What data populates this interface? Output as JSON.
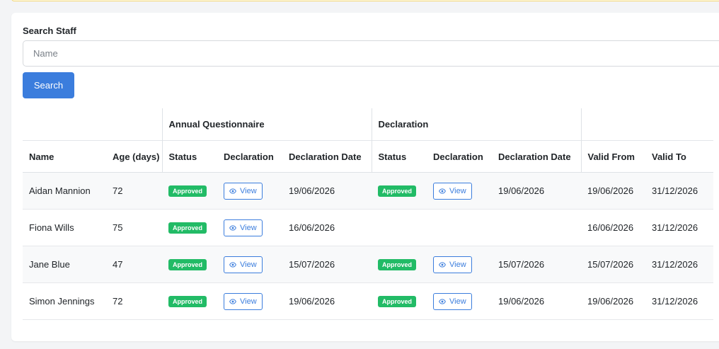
{
  "search": {
    "label": "Search Staff",
    "placeholder": "Name",
    "value": "",
    "button_label": "Search"
  },
  "table": {
    "groups": {
      "annual": "Annual Questionnaire",
      "declaration": "Declaration"
    },
    "columns": {
      "name": "Name",
      "age": "Age (days)",
      "aq_status": "Status",
      "aq_declaration": "Declaration",
      "aq_date": "Declaration Date",
      "d_status": "Status",
      "d_declaration": "Declaration",
      "d_date": "Declaration Date",
      "valid_from": "Valid From",
      "valid_to": "Valid To"
    },
    "rows": [
      {
        "name": "Aidan Mannion",
        "age": "72",
        "aq_status": "Approved",
        "aq_view": "View",
        "aq_date": "19/06/2026",
        "d_status": "Approved",
        "d_view": "View",
        "d_date": "19/06/2026",
        "valid_from": "19/06/2026",
        "valid_to": "31/12/2026"
      },
      {
        "name": "Fiona Wills",
        "age": "75",
        "aq_status": "Approved",
        "aq_view": "View",
        "aq_date": "16/06/2026",
        "d_status": "",
        "d_view": "",
        "d_date": "",
        "valid_from": "16/06/2026",
        "valid_to": "31/12/2026"
      },
      {
        "name": "Jane Blue",
        "age": "47",
        "aq_status": "Approved",
        "aq_view": "View",
        "aq_date": "15/07/2026",
        "d_status": "Approved",
        "d_view": "View",
        "d_date": "15/07/2026",
        "valid_from": "15/07/2026",
        "valid_to": "31/12/2026"
      },
      {
        "name": "Simon Jennings",
        "age": "72",
        "aq_status": "Approved",
        "aq_view": "View",
        "aq_date": "19/06/2026",
        "d_status": "Approved",
        "d_view": "View",
        "d_date": "19/06/2026",
        "valid_from": "19/06/2026",
        "valid_to": "31/12/2026"
      }
    ]
  },
  "icons": {
    "view": "eye-icon"
  },
  "colors": {
    "primary": "#3b7ddd",
    "approved_badge": "#22bb66",
    "warning_border": "#f3d77a"
  }
}
